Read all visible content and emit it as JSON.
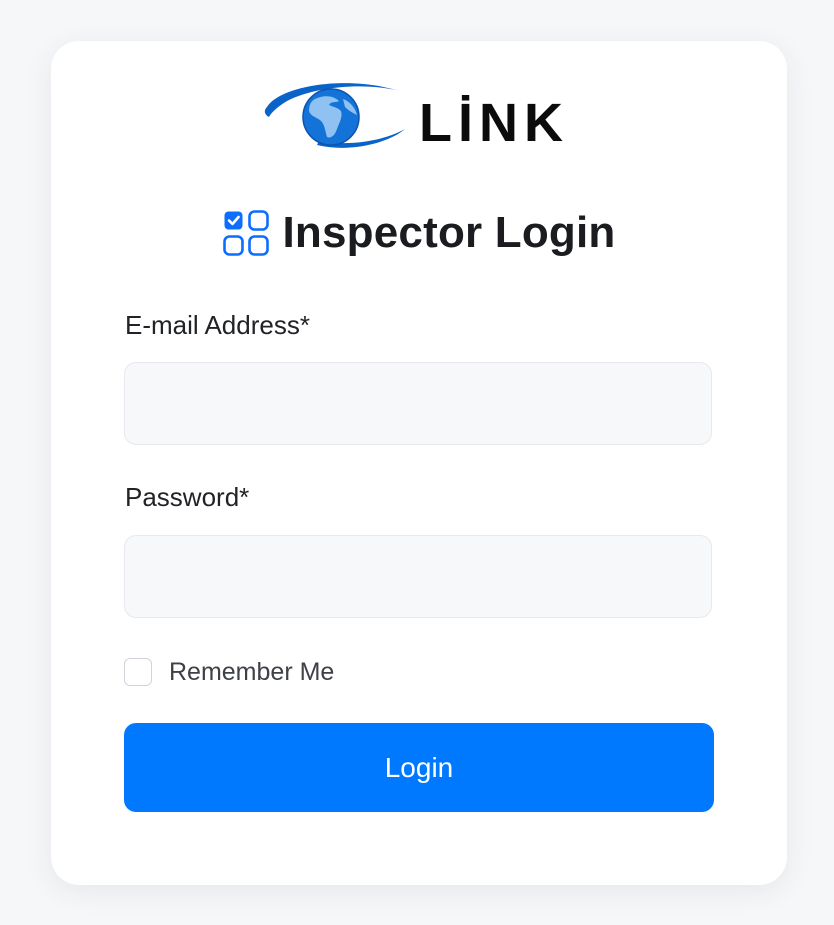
{
  "logo": {
    "text": "LİNK",
    "colors": {
      "primary": "#0a63c9",
      "text": "#0b0b0b"
    }
  },
  "header": {
    "title": "Inspector Login",
    "icon": "grid-check-icon"
  },
  "form": {
    "email": {
      "label": "E-mail Address*",
      "value": "",
      "placeholder": ""
    },
    "password": {
      "label": "Password*",
      "value": "",
      "placeholder": ""
    },
    "remember": {
      "label": "Remember Me",
      "checked": false
    },
    "submit_label": "Login"
  },
  "colors": {
    "accent": "#0079ff",
    "input_bg": "#f7f8fa",
    "page_bg": "#f6f7f9"
  }
}
